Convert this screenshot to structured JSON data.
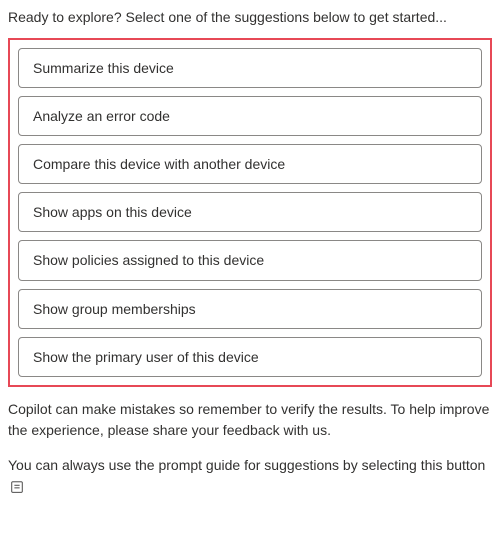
{
  "intro": "Ready to explore? Select one of the suggestions below to get started...",
  "suggestions": [
    {
      "label": "Summarize this device"
    },
    {
      "label": "Analyze an error code"
    },
    {
      "label": "Compare this device with another device"
    },
    {
      "label": "Show apps on this device"
    },
    {
      "label": "Show policies assigned to this device"
    },
    {
      "label": "Show group memberships"
    },
    {
      "label": "Show the primary user of this device"
    }
  ],
  "disclaimer": "Copilot can make mistakes so remember to verify the results. To help improve the experience, please share your feedback with us.",
  "prompt_guide_text": "You can always use the prompt guide for suggestions by selecting this button"
}
